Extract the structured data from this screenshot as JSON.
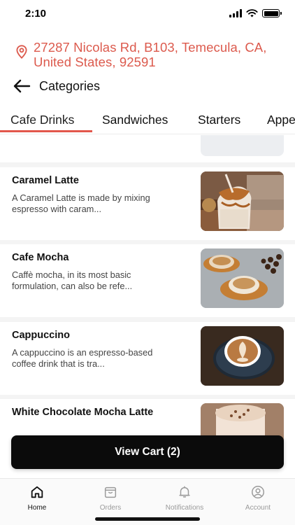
{
  "status_bar": {
    "time": "2:10"
  },
  "address": {
    "text": "27287 Nicolas Rd, B103, Temecula, CA, United States, 92591"
  },
  "header": {
    "title": "Categories"
  },
  "tabs": [
    {
      "label": "Cafe Drinks",
      "active": true
    },
    {
      "label": "Sandwiches",
      "active": false
    },
    {
      "label": "Starters",
      "active": false
    },
    {
      "label": "Appe",
      "active": false
    }
  ],
  "items": [
    {
      "name": "Caramel Latte",
      "description": "A Caramel Latte is made by mixing espresso with caram..."
    },
    {
      "name": "Cafe Mocha",
      "description": "Caffè mocha, in its most basic formulation, can also be refe..."
    },
    {
      "name": "Cappuccino",
      "description": "A cappuccino is an espresso-based coffee drink that is tra..."
    },
    {
      "name": "White Chocolate Mocha Latte",
      "description": ""
    }
  ],
  "cart": {
    "label": "View Cart (2)"
  },
  "bottom_nav": [
    {
      "label": "Home",
      "icon": "home-icon",
      "active": true
    },
    {
      "label": "Orders",
      "icon": "orders-icon",
      "active": false
    },
    {
      "label": "Notifications",
      "icon": "bell-icon",
      "active": false
    },
    {
      "label": "Account",
      "icon": "account-icon",
      "active": false
    }
  ],
  "colors": {
    "accent": "#e2574c",
    "address": "#dc5a4d",
    "cart_button": "#0b0b0b"
  }
}
